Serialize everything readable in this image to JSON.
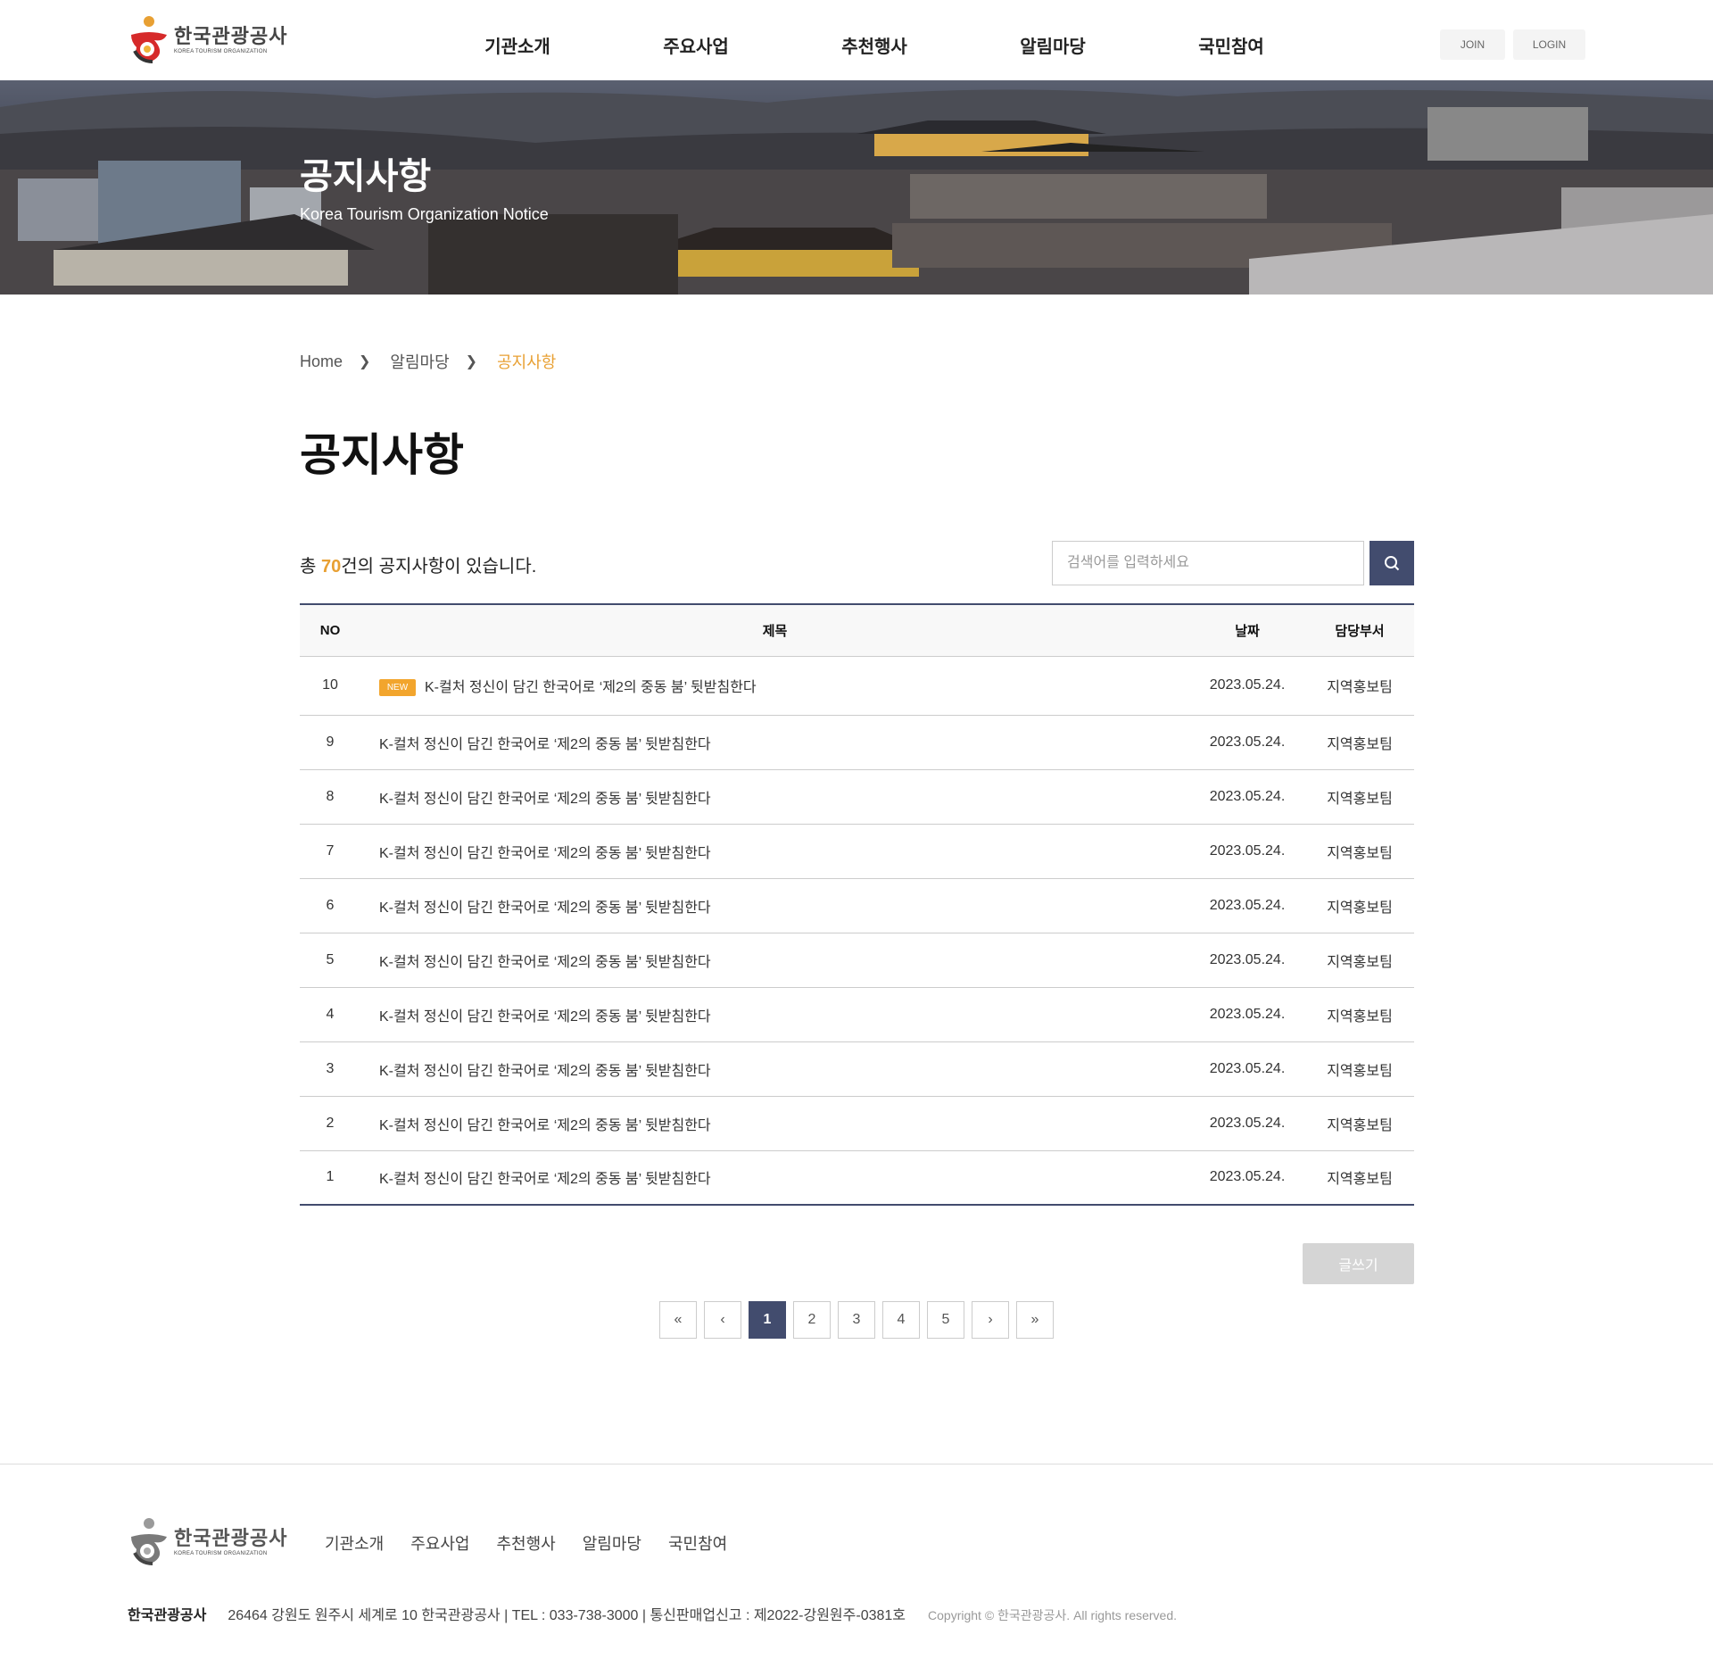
{
  "header": {
    "logo": {
      "ko": "한국관광공사",
      "en": "KOREA TOURISM ORGANIZATION"
    },
    "nav": [
      "기관소개",
      "주요사업",
      "추천행사",
      "알림마당",
      "국민참여"
    ],
    "join": "JOIN",
    "login": "LOGIN"
  },
  "hero": {
    "title": "공지사항",
    "subtitle": "Korea Tourism Organization Notice"
  },
  "breadcrumb": {
    "home": "Home",
    "level1": "알림마당",
    "current": "공지사항"
  },
  "page_title": "공지사항",
  "count": {
    "prefix": "총 ",
    "number": "70",
    "suffix": "건의 공지사항이 있습니다."
  },
  "search": {
    "placeholder": "검색어를 입력하세요",
    "value": ""
  },
  "table": {
    "headers": {
      "no": "NO",
      "title": "제목",
      "date": "날짜",
      "dept": "담당부서"
    },
    "new_label": "NEW",
    "rows": [
      {
        "no": "10",
        "title": "K-컬처 정신이 담긴 한국어로 ‘제2의 중동 붐’ 뒷받침한다",
        "date": "2023.05.24.",
        "dept": "지역홍보팀",
        "is_new": true
      },
      {
        "no": "9",
        "title": "K-컬처 정신이 담긴 한국어로 ‘제2의 중동 붐’ 뒷받침한다",
        "date": "2023.05.24.",
        "dept": "지역홍보팀",
        "is_new": false
      },
      {
        "no": "8",
        "title": "K-컬처 정신이 담긴 한국어로 ‘제2의 중동 붐’ 뒷받침한다",
        "date": "2023.05.24.",
        "dept": "지역홍보팀",
        "is_new": false
      },
      {
        "no": "7",
        "title": "K-컬처 정신이 담긴 한국어로 ‘제2의 중동 붐’ 뒷받침한다",
        "date": "2023.05.24.",
        "dept": "지역홍보팀",
        "is_new": false
      },
      {
        "no": "6",
        "title": "K-컬처 정신이 담긴 한국어로 ‘제2의 중동 붐’ 뒷받침한다",
        "date": "2023.05.24.",
        "dept": "지역홍보팀",
        "is_new": false
      },
      {
        "no": "5",
        "title": "K-컬처 정신이 담긴 한국어로 ‘제2의 중동 붐’ 뒷받침한다",
        "date": "2023.05.24.",
        "dept": "지역홍보팀",
        "is_new": false
      },
      {
        "no": "4",
        "title": "K-컬처 정신이 담긴 한국어로 ‘제2의 중동 붐’ 뒷받침한다",
        "date": "2023.05.24.",
        "dept": "지역홍보팀",
        "is_new": false
      },
      {
        "no": "3",
        "title": "K-컬처 정신이 담긴 한국어로 ‘제2의 중동 붐’ 뒷받침한다",
        "date": "2023.05.24.",
        "dept": "지역홍보팀",
        "is_new": false
      },
      {
        "no": "2",
        "title": "K-컬처 정신이 담긴 한국어로 ‘제2의 중동 붐’ 뒷받침한다",
        "date": "2023.05.24.",
        "dept": "지역홍보팀",
        "is_new": false
      },
      {
        "no": "1",
        "title": "K-컬처 정신이 담긴 한국어로 ‘제2의 중동 붐’ 뒷받침한다",
        "date": "2023.05.24.",
        "dept": "지역홍보팀",
        "is_new": false
      }
    ]
  },
  "write_button": "글쓰기",
  "pagination": {
    "first": "«",
    "prev": "‹",
    "next": "›",
    "last": "»",
    "pages": [
      "1",
      "2",
      "3",
      "4",
      "5"
    ],
    "current": "1"
  },
  "footer": {
    "logo": {
      "ko": "한국관광공사",
      "en": "KOREA TOURISM ORGANIZATION"
    },
    "nav": [
      "기관소개",
      "주요사업",
      "추천행사",
      "알림마당",
      "국민참여"
    ],
    "org": "한국관광공사",
    "address": "26464 강원도 원주시 세계로 10 한국관광공사 | TEL : 033-738-3000 | 통신판매업신고 : 제2022-강원원주-0381호",
    "copyright": "Copyright © 한국관광공사. All rights reserved."
  },
  "colors": {
    "accent": "#e8a033",
    "navy": "#424c6e",
    "new_badge": "#f2a52d"
  },
  "icons": {
    "search": "search-icon",
    "logo": "kto-logo-icon"
  }
}
